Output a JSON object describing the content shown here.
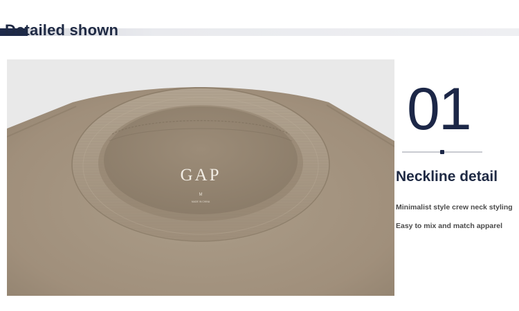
{
  "header": {
    "title": "Detailed shown"
  },
  "photo": {
    "label_brand": "GAP",
    "label_size": "M",
    "label_small_text": "MADE IN CHINA",
    "garment_color": "#a39581"
  },
  "detail": {
    "number": "01",
    "heading": "Neckline detail",
    "lines": [
      "Minimalist style crew neck styling",
      "Easy to mix and match apparel"
    ]
  },
  "colors": {
    "navy": "#1c2747",
    "band": "#e9eaee",
    "text_gray": "#4a4a4a"
  }
}
